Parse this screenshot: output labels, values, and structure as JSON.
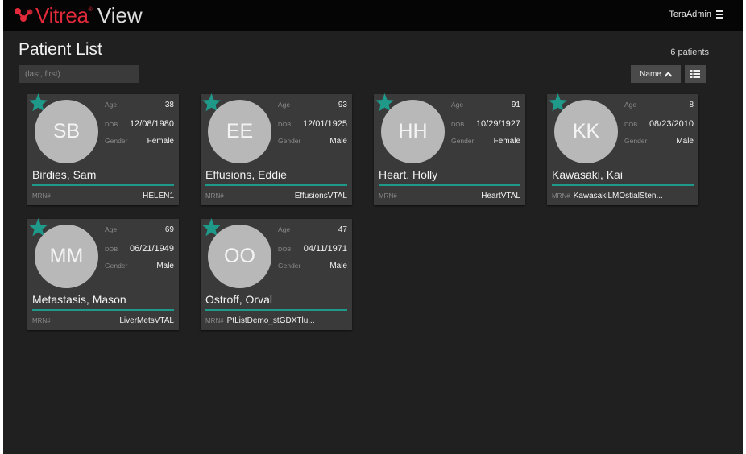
{
  "app": {
    "logo_primary": "Vitrea",
    "logo_tm": "®",
    "logo_secondary": "View",
    "user": "TeraAdmin",
    "menu_icon": "hamburger-icon",
    "brand_colors": {
      "red": "#e22a3a",
      "teal": "#1f9a8a"
    }
  },
  "page": {
    "title": "Patient List",
    "count_label": "6 patients",
    "search_placeholder": "(last, first)",
    "sort_label": "Name",
    "sort_icon": "chevron-up-icon",
    "view_toggle_icon": "list-view-icon"
  },
  "labels": {
    "age": "Age",
    "dob": "DOB",
    "gender": "Gender",
    "mrn": "MRN#"
  },
  "patients": [
    {
      "initials": "SB",
      "name": "Birdies, Sam",
      "age": "38",
      "dob": "12/08/1980",
      "gender": "Female",
      "mrn": "HELEN1"
    },
    {
      "initials": "EE",
      "name": "Effusions, Eddie",
      "age": "93",
      "dob": "12/01/1925",
      "gender": "Male",
      "mrn": "EffusionsVTAL"
    },
    {
      "initials": "HH",
      "name": "Heart, Holly",
      "age": "91",
      "dob": "10/29/1927",
      "gender": "Female",
      "mrn": "HeartVTAL"
    },
    {
      "initials": "KK",
      "name": "Kawasaki, Kai",
      "age": "8",
      "dob": "08/23/2010",
      "gender": "Male",
      "mrn": "KawasakiLMOstialSten..."
    },
    {
      "initials": "MM",
      "name": "Metastasis, Mason",
      "age": "69",
      "dob": "06/21/1949",
      "gender": "Male",
      "mrn": "LiverMetsVTAL"
    },
    {
      "initials": "OO",
      "name": "Ostroff, Orval",
      "age": "47",
      "dob": "04/11/1971",
      "gender": "Male",
      "mrn": "PtListDemo_stGDXTlu..."
    }
  ]
}
